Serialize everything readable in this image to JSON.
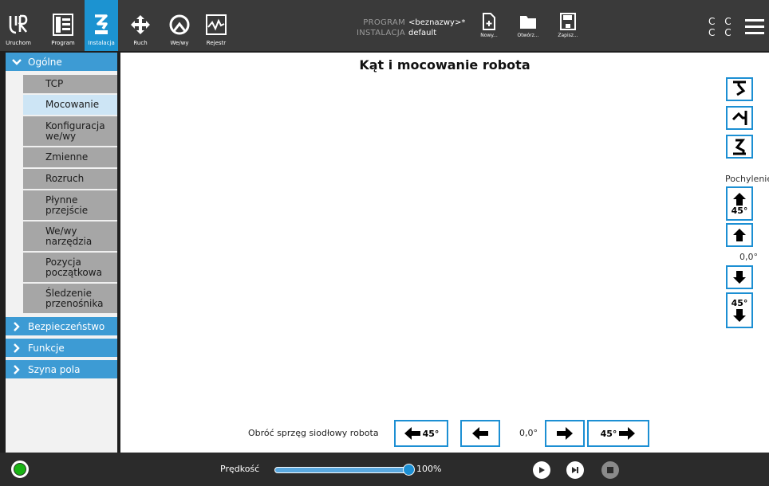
{
  "topbar": {
    "tabs": [
      {
        "label": "Uruchom"
      },
      {
        "label": "Program"
      },
      {
        "label": "Instalacja"
      },
      {
        "label": "Ruch"
      },
      {
        "label": "We/wy"
      },
      {
        "label": "Rejestr"
      }
    ],
    "program_key": "PROGRAM",
    "program_value": "<beznazwy>*",
    "install_key": "INSTALACJA",
    "install_value": "default",
    "new_label": "Nowy...",
    "open_label": "Otwórz...",
    "save_label": "Zapisz...",
    "cc_row1": "C C",
    "cc_row2": "C C"
  },
  "sidebar": {
    "general": "Ogólne",
    "items": [
      {
        "label": "TCP"
      },
      {
        "label": "Mocowanie"
      },
      {
        "label": "Konfiguracja we/wy"
      },
      {
        "label": "Zmienne"
      },
      {
        "label": "Rozruch"
      },
      {
        "label": "Płynne przejście"
      },
      {
        "label": "We/wy narzędzia"
      },
      {
        "label": "Pozycja początkowa"
      },
      {
        "label": "Śledzenie przenośnika"
      }
    ],
    "safety": "Bezpieczeństwo",
    "features": "Funkcje",
    "fieldbus": "Szyna pola"
  },
  "main": {
    "title": "Kąt i mocowanie robota",
    "tilt_label": "Pochylenie",
    "tilt_up45": "45°",
    "tilt_value": "0,0°",
    "tilt_down45": "45°",
    "rotate_label": "Obróć sprzęg siodłowy robota",
    "rot_left45": "45°",
    "rot_value": "0,0°",
    "rot_right45": "45°"
  },
  "bottombar": {
    "speed_label": "Prędkość",
    "speed_value": "100%",
    "speed_fraction": 1.0
  },
  "colors": {
    "accent": "#1c93d1",
    "section_header": "#3d9bd4",
    "selected_item": "#cde5f5",
    "submenu_item": "#a6a6a6",
    "power_on": "#19b314"
  }
}
